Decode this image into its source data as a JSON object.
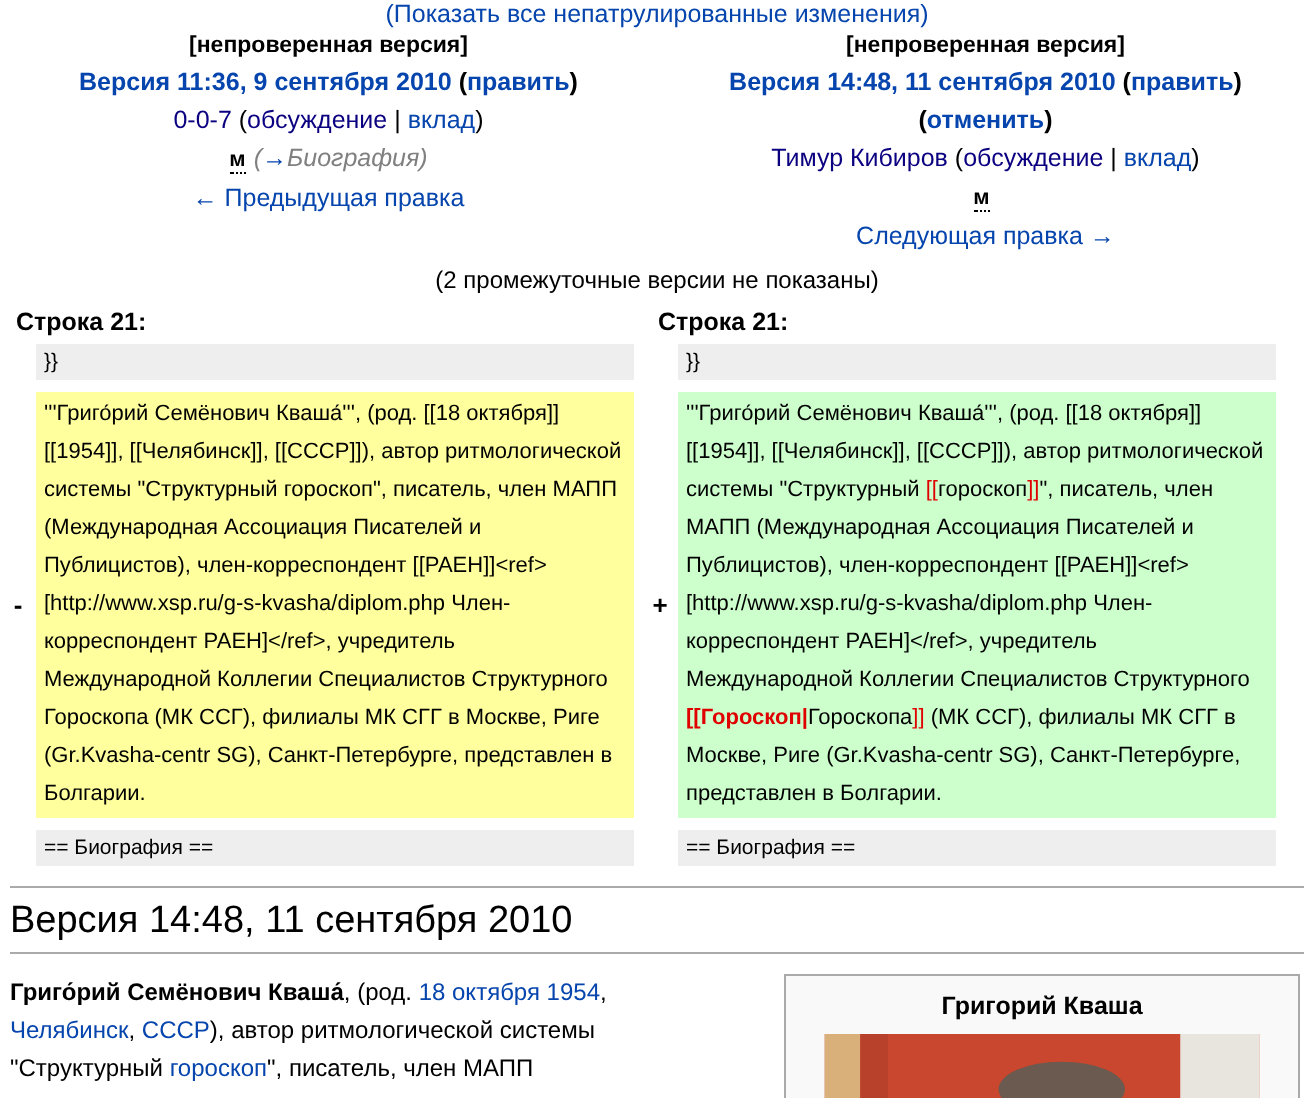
{
  "top_link": "(Показать все непатрулированные изменения)",
  "columns": [
    {
      "lines": [
        {
          "kind": "status",
          "parts": [
            {
              "kind": "plain",
              "text": "[непроверенная версия]"
            }
          ]
        },
        {
          "kind": "version",
          "parts": [
            {
              "kind": "link",
              "text": "Версия 11:36, 9 сентября 2010"
            },
            {
              "kind": "plain",
              "text": " ("
            },
            {
              "kind": "link",
              "text": "править"
            },
            {
              "kind": "plain",
              "text": ")"
            }
          ]
        },
        {
          "kind": "user",
          "parts": [
            {
              "kind": "visited",
              "text": "0-0-7"
            },
            {
              "kind": "plain",
              "text": " ("
            },
            {
              "kind": "visited",
              "text": "обсуждение"
            },
            {
              "kind": "plain",
              "text": " | "
            },
            {
              "kind": "link",
              "text": "вклад"
            },
            {
              "kind": "plain",
              "text": ")"
            }
          ]
        },
        {
          "kind": "summary",
          "parts": [
            {
              "kind": "minor",
              "text": "м"
            },
            {
              "kind": "comment",
              "text": "("
            },
            {
              "kind": "comment_link",
              "text": "→"
            },
            {
              "kind": "comment",
              "text": "Биография)"
            }
          ]
        },
        {
          "kind": "nav",
          "parts": [
            {
              "kind": "link",
              "text": "← Предыдущая правка"
            }
          ]
        }
      ],
      "line_label": "Строка 21:",
      "marker": "-",
      "kind": "deleted",
      "context_before": "}}",
      "changed_text": [
        {
          "kind": "plain",
          "text": "'''Григо́рий Семёнович Кваша́''', (род. [[18 октября]] [[1954]], [[Челябинск]], [[СССР]]), автор ритмологической системы \"Структурный гороскоп\", писатель, член МАПП (Международная Ассоциация Писателей и Публицистов), член-корреспондент [[РАЕН]]<ref>[http://www.xsp.ru/g-s-kvasha/diplom.php Член-корреспондент РАЕН]</ref>, учредитель Международной Коллегии Специалистов Структурного Гороскопа (МК ССГ), филиалы МК СГГ в Москве, Риге (Gr.Kvasha-centr SG), Санкт-Петербурге, представлен в Болгарии."
        }
      ],
      "context_after": "== Биография =="
    },
    {
      "lines": [
        {
          "kind": "status",
          "parts": [
            {
              "kind": "plain",
              "text": "[непроверенная версия]"
            }
          ]
        },
        {
          "kind": "version",
          "parts": [
            {
              "kind": "link",
              "text": "Версия 14:48, 11 сентября 2010"
            },
            {
              "kind": "plain",
              "text": " ("
            },
            {
              "kind": "link",
              "text": "править"
            },
            {
              "kind": "plain",
              "text": ")"
            }
          ]
        },
        {
          "kind": "version",
          "parts": [
            {
              "kind": "plain",
              "text": "("
            },
            {
              "kind": "link",
              "text": "отменить"
            },
            {
              "kind": "plain",
              "text": ")"
            }
          ]
        },
        {
          "kind": "user",
          "parts": [
            {
              "kind": "visited",
              "text": "Тимур Кибиров"
            },
            {
              "kind": "plain",
              "text": " ("
            },
            {
              "kind": "visited",
              "text": "обсуждение"
            },
            {
              "kind": "plain",
              "text": " | "
            },
            {
              "kind": "link",
              "text": "вклад"
            },
            {
              "kind": "plain",
              "text": ")"
            }
          ]
        },
        {
          "kind": "summary",
          "parts": [
            {
              "kind": "minor",
              "text": "м"
            }
          ]
        },
        {
          "kind": "nav",
          "parts": [
            {
              "kind": "link",
              "text": "Следующая правка →"
            }
          ]
        }
      ],
      "line_label": "Строка 21:",
      "marker": "+",
      "kind": "added",
      "context_before": "}}",
      "changed_text": [
        {
          "kind": "plain",
          "text": "'''Григо́рий Семёнович Кваша́''', (род. [[18 октября]] [[1954]], [[Челябинск]], [[СССР]]), автор ритмологической системы \"Структурный "
        },
        {
          "kind": "changed",
          "text": "[["
        },
        {
          "kind": "plain",
          "text": "гороскоп"
        },
        {
          "kind": "changed",
          "text": "]]"
        },
        {
          "kind": "plain",
          "text": "\", писатель, член МАПП (Международная Ассоциация Писателей и Публицистов), член-корреспондент [[РАЕН]]<ref>[http://www.xsp.ru/g-s-kvasha/diplom.php Член-корреспондент РАЕН]</ref>, учредитель Международной Коллегии Специалистов Структурного "
        },
        {
          "kind": "changed_bold",
          "text": "[[Гороскоп|"
        },
        {
          "kind": "plain",
          "text": "Гороскопа"
        },
        {
          "kind": "changed",
          "text": "]]"
        },
        {
          "kind": "plain",
          "text": " (МК ССГ), филиалы МК СГГ в Москве, Риге (Gr.Kvasha-centr SG), Санкт-Петербурге, представлен в Болгарии."
        }
      ],
      "context_after": "== Биография =="
    }
  ],
  "hidden_note": "(2 промежуточные версии не показаны)",
  "revision_heading": "Версия 14:48, 11 сентября 2010",
  "article": [
    {
      "kind": "bold",
      "text": "Григо́рий Семёнович Кваша́"
    },
    {
      "kind": "plain",
      "text": ", (род. "
    },
    {
      "kind": "link",
      "text": "18 октября 1954"
    },
    {
      "kind": "plain",
      "text": ", "
    },
    {
      "kind": "link",
      "text": "Челябинск"
    },
    {
      "kind": "plain",
      "text": ", "
    },
    {
      "kind": "link",
      "text": "СССР"
    },
    {
      "kind": "plain",
      "text": "), автор ритмологической системы \"Структурный "
    },
    {
      "kind": "link",
      "text": "гороскоп"
    },
    {
      "kind": "plain",
      "text": "\", писатель, член МАПП"
    }
  ],
  "infobox": {
    "title": "Григорий Кваша"
  }
}
